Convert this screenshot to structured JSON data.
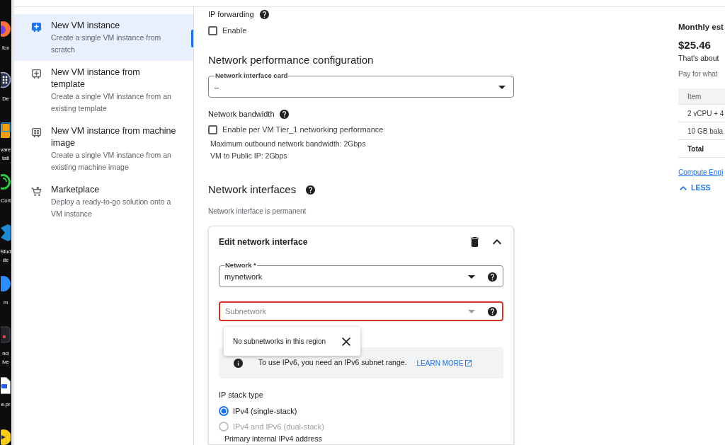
{
  "desktop": {
    "shortcuts": [
      {
        "kind": "orb",
        "label_lines": [
          "fox"
        ]
      },
      {
        "kind": "dots",
        "label_lines": [
          "De"
        ]
      },
      {
        "kind": "window",
        "label_lines": [
          "vare",
          "tati"
        ]
      },
      {
        "kind": "ring",
        "label_lines": [
          "Cort"
        ]
      },
      {
        "kind": "ribbon",
        "label_lines": [
          "Stud",
          "de"
        ]
      },
      {
        "kind": "bubble",
        "label_lines": [
          "m"
        ]
      },
      {
        "kind": "tile",
        "label_lines": [
          "nci",
          "lve"
        ]
      },
      {
        "kind": "file",
        "label_lines": [
          "e.pr"
        ]
      },
      {
        "kind": "badge"
      }
    ]
  },
  "sidebar": {
    "items": [
      {
        "kind": "new",
        "title": "New VM instance",
        "description": "Create a single VM instance from scratch",
        "selected": true
      },
      {
        "kind": "template",
        "title": "New VM instance from template",
        "description": "Create a single VM instance from an existing template",
        "selected": false
      },
      {
        "kind": "machine_image",
        "title": "New VM instance from machine image",
        "description": "Create a single VM instance from an existing machine image",
        "selected": false
      },
      {
        "kind": "marketplace",
        "title": "Marketplace",
        "description": "Deploy a ready-to-go solution onto a VM instance",
        "selected": false
      }
    ]
  },
  "form": {
    "ip_forwarding": {
      "label": "IP forwarding",
      "checkbox": {
        "label": "Enable",
        "checked": false
      }
    },
    "network_performance": {
      "heading": "Network performance configuration",
      "nic_select": {
        "label": "Network interface card",
        "value": "–"
      }
    },
    "network_bandwidth": {
      "label": "Network bandwidth",
      "checkbox": {
        "label": "Enable per VM Tier_1 networking performance",
        "checked": false
      },
      "notes": [
        "Maximum outbound network bandwidth: 2Gbps",
        "VM to Public IP: 2Gbps"
      ]
    },
    "network_interfaces": {
      "heading": "Network interfaces",
      "note": "Network interface is permanent",
      "card": {
        "title": "Edit network interface",
        "expanded": true,
        "network_select": {
          "label": "Network *",
          "value": "mynetwork"
        },
        "subnetwork_select": {
          "placeholder": "Subnetwork",
          "error": true
        },
        "popup": {
          "message": "No subnetworks in this region"
        },
        "info_banner": {
          "text": "To use IPv6, you need an IPv6 subnet range.",
          "link": "LEARN MORE"
        },
        "ip_stack_type": {
          "label": "IP stack type",
          "options": [
            {
              "label": "IPv4 (single-stack)",
              "selected": true,
              "disabled": false
            },
            {
              "label": "IPv4 and IPv6 (dual-stack)",
              "selected": false,
              "disabled": true
            }
          ]
        },
        "next_field_label": "Primary internal IPv4 address"
      }
    }
  },
  "estimate": {
    "title": "Monthly est",
    "price": "$25.46",
    "subtitle": "That's about",
    "note": "Pay for what",
    "table": {
      "columns": [
        "Item"
      ],
      "rows": [
        {
          "kind": "line",
          "cells": [
            "2 vCPU + 4"
          ]
        },
        {
          "kind": "line",
          "cells": [
            "10 GB bala"
          ]
        },
        {
          "kind": "total",
          "cells": [
            "Total"
          ]
        }
      ]
    },
    "link": "Compute Engi",
    "toggle": {
      "label": "LESS",
      "expanded": true
    }
  }
}
